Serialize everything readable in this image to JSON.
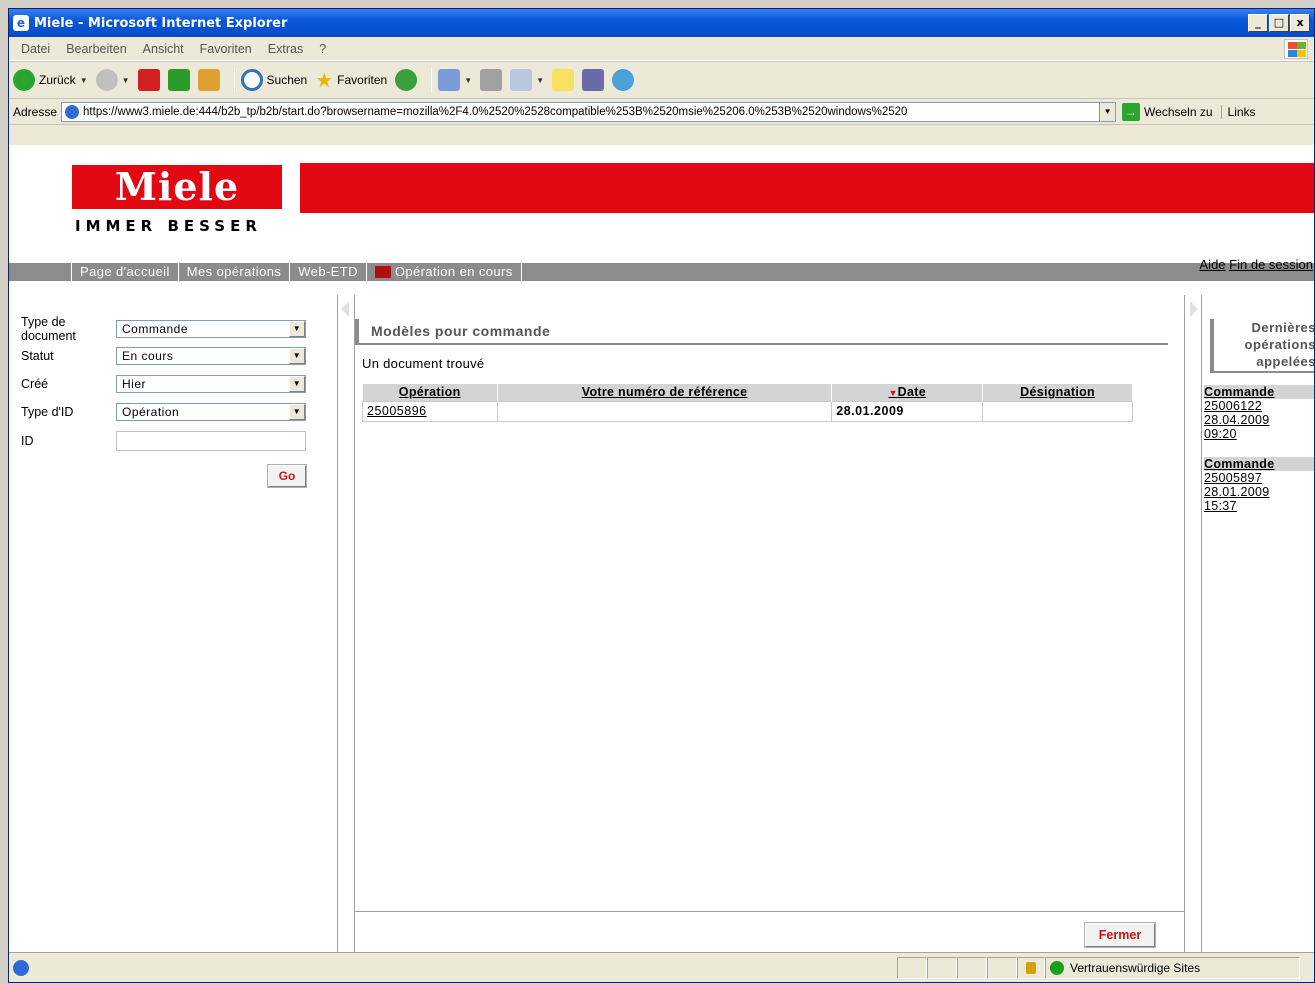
{
  "window": {
    "title": "Miele - Microsoft Internet Explorer",
    "btn_min": "_",
    "btn_max": "□",
    "btn_close": "x"
  },
  "menu": [
    "Datei",
    "Bearbeiten",
    "Ansicht",
    "Favoriten",
    "Extras",
    "?"
  ],
  "toolbar": {
    "back": "Zurück",
    "search": "Suchen",
    "favorites": "Favoriten"
  },
  "address": {
    "label": "Adresse",
    "url": "https://www3.miele.de:444/b2b_tp/b2b/start.do?browsername=mozilla%2F4.0%2520%2528compatible%253B%2520msie%25206.0%253B%2520windows%2520",
    "go": "Wechseln zu",
    "links": "Links"
  },
  "brand": {
    "logo": "Miele",
    "tagline": "IMMER BESSER",
    "color": "#e30613"
  },
  "toplinks": {
    "help": "Aide",
    "logout": "Fin de session"
  },
  "nav": {
    "tabs": [
      "Page d'accueil",
      "Mes opérations",
      "Web-ETD",
      "Opération en cours"
    ]
  },
  "search": {
    "doc_type_label": "Type de document",
    "doc_type_value": "Commande",
    "status_label": "Statut",
    "status_value": "En cours",
    "created_label": "Créé",
    "created_value": "Hier",
    "id_type_label": "Type d'ID",
    "id_type_value": "Opération",
    "id_label": "ID",
    "id_value": "",
    "go": "Go"
  },
  "main": {
    "title": "Modèles pour commande",
    "found": "Un document trouvé",
    "columns": [
      "Opération",
      "Votre numéro de référence",
      "Date",
      "Désignation"
    ],
    "rows": [
      {
        "operation": "25005896",
        "reference": "",
        "date": "28.01.2009",
        "designation": ""
      }
    ],
    "close": "Fermer"
  },
  "recent": {
    "title": "Dernières opérations appelées",
    "items": [
      {
        "type": "Commande",
        "number": "25006122",
        "date": "28.04.2009",
        "time": "09:20"
      },
      {
        "type": "Commande",
        "number": "25005897",
        "date": "28.01.2009",
        "time": "15:37"
      }
    ]
  },
  "status": {
    "zone": "Vertrauenswürdige Sites"
  }
}
